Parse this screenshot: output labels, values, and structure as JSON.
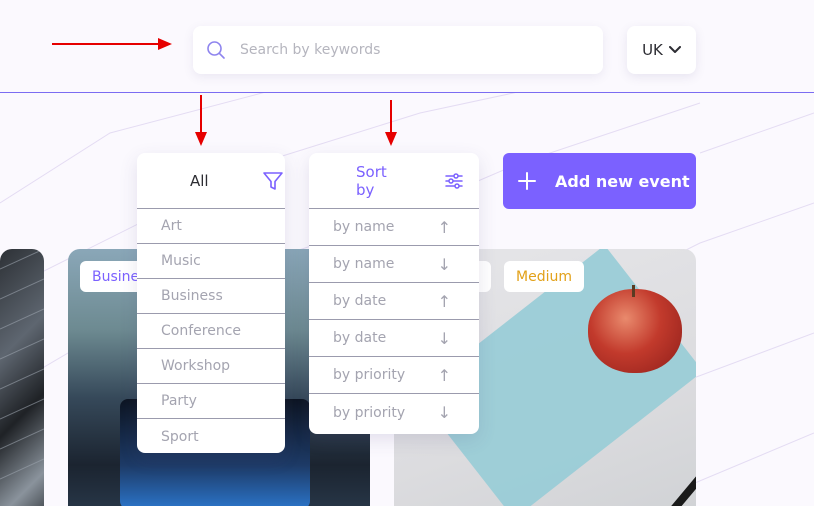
{
  "search": {
    "placeholder": "Search by keywords",
    "icon": "search-icon"
  },
  "language": {
    "selected": "UK",
    "icon": "chevron-down-icon"
  },
  "filter": {
    "selected": "All",
    "icon": "filter-icon",
    "options": [
      "Art",
      "Music",
      "Business",
      "Conference",
      "Workshop",
      "Party",
      "Sport"
    ]
  },
  "sort": {
    "label": "Sort by",
    "icon": "sliders-icon",
    "options": [
      {
        "label": "by name",
        "direction": "↑"
      },
      {
        "label": "by name",
        "direction": "↓"
      },
      {
        "label": "by date",
        "direction": "↑"
      },
      {
        "label": "by date",
        "direction": "↓"
      },
      {
        "label": "by priority",
        "direction": "↑"
      },
      {
        "label": "by priority",
        "direction": "↓"
      }
    ]
  },
  "add_event": {
    "label": "Add new event",
    "icon": "plus-icon"
  },
  "cards": {
    "middle_badge": "Busine",
    "right_badge": "Medium"
  },
  "colors": {
    "accent": "#7b61ff",
    "priority_medium": "#e2a119",
    "annotation": "#e60000"
  }
}
